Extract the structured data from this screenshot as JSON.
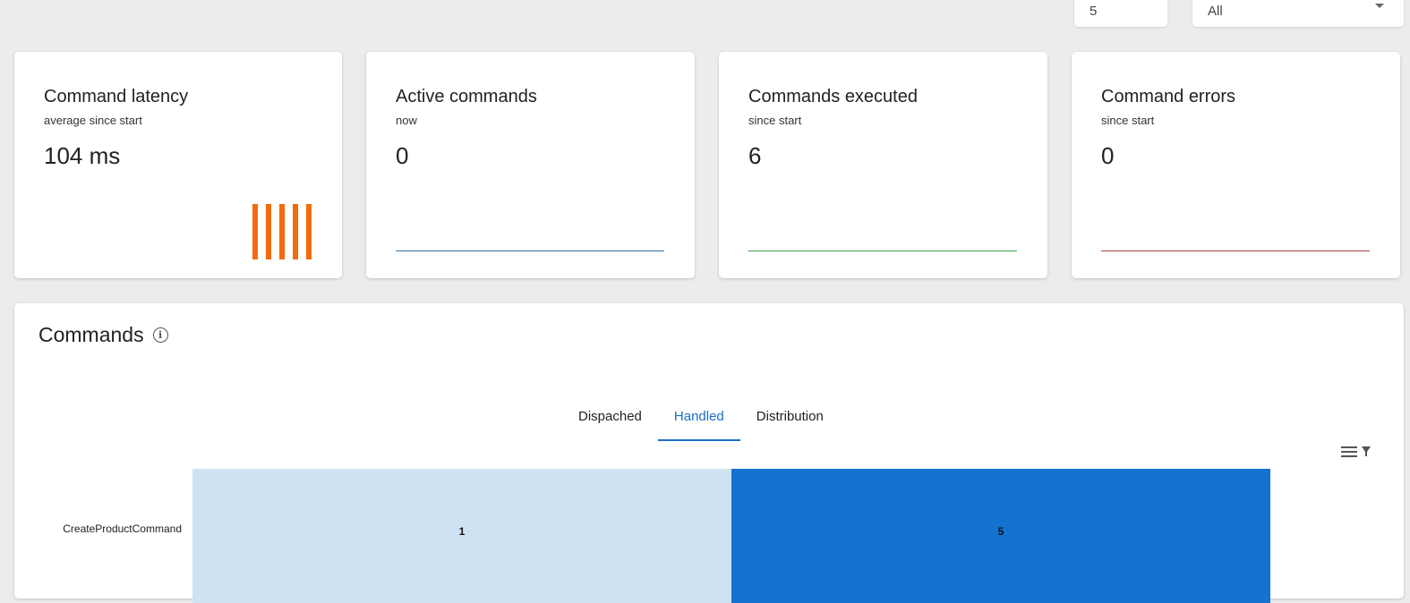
{
  "topbar": {
    "limit_value": "5",
    "filter_value": "All"
  },
  "cards": [
    {
      "title": "Command latency",
      "subtitle": "average since start",
      "value": "104 ms",
      "sparkline_color": "#f26b0f"
    },
    {
      "title": "Active commands",
      "subtitle": "now",
      "value": "0",
      "sparkline_color": "#2b6ea8"
    },
    {
      "title": "Commands executed",
      "subtitle": "since start",
      "value": "6",
      "sparkline_color": "#3aa04a"
    },
    {
      "title": "Command errors",
      "subtitle": "since start",
      "value": "0",
      "sparkline_color": "#b23c3c"
    }
  ],
  "panel": {
    "title": "Commands",
    "info_icon": "info-icon",
    "tabs": [
      {
        "label": "Dispached",
        "active": false
      },
      {
        "label": "Handled",
        "active": true
      },
      {
        "label": "Distribution",
        "active": false
      }
    ],
    "menu_icon": "hamburger-filter-icon"
  },
  "chart_data": {
    "type": "bar",
    "orientation": "horizontal",
    "stacked": true,
    "categories": [
      "CreateProductCommand"
    ],
    "series": [
      {
        "values": [
          1
        ],
        "color": "#cfe2f3"
      },
      {
        "values": [
          5
        ],
        "color": "#1473d0"
      }
    ],
    "data_labels": true
  }
}
